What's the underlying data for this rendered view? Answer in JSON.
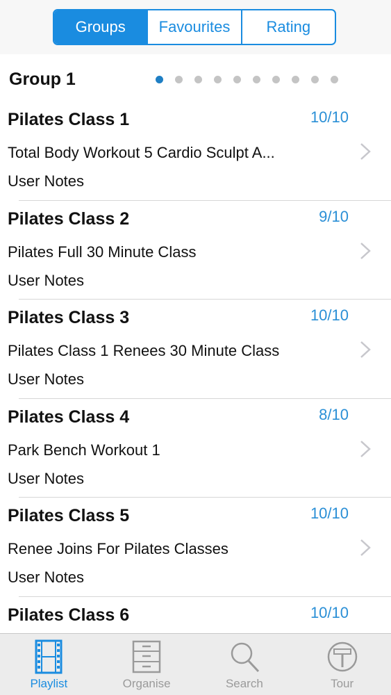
{
  "segments": [
    {
      "label": "Groups",
      "active": true
    },
    {
      "label": "Favourites",
      "active": false
    },
    {
      "label": "Rating",
      "active": false
    }
  ],
  "group": {
    "title": "Group 1",
    "page_count": 10,
    "current_page": 1
  },
  "rows": [
    {
      "title": "Pilates Class 1",
      "rating": "10/10",
      "subtitle": "Total Body Workout 5 Cardio Sculpt A...",
      "notes": "User Notes"
    },
    {
      "title": "Pilates Class 2",
      "rating": "9/10",
      "subtitle": "Pilates Full 30 Minute Class",
      "notes": "User Notes"
    },
    {
      "title": "Pilates Class 3",
      "rating": "10/10",
      "subtitle": "Pilates Class 1 Renees 30 Minute Class",
      "notes": "User Notes"
    },
    {
      "title": "Pilates Class 4",
      "rating": "8/10",
      "subtitle": "Park Bench Workout 1",
      "notes": "User Notes"
    },
    {
      "title": "Pilates Class 5",
      "rating": "10/10",
      "subtitle": "Renee Joins  For Pilates Classes",
      "notes": "User Notes"
    },
    {
      "title": "Pilates Class 6",
      "rating": "10/10",
      "subtitle": "",
      "notes": ""
    }
  ],
  "tabs": [
    {
      "label": "Playlist",
      "icon": "film-strip-icon",
      "active": true
    },
    {
      "label": "Organise",
      "icon": "filing-cabinet-icon",
      "active": false
    },
    {
      "label": "Search",
      "icon": "magnifier-icon",
      "active": false
    },
    {
      "label": "Tour",
      "icon": "signpost-icon",
      "active": false
    }
  ],
  "colors": {
    "accent": "#1a8ce0",
    "rating": "#2a8fd6",
    "inactive_tab": "#9a9a9a"
  }
}
